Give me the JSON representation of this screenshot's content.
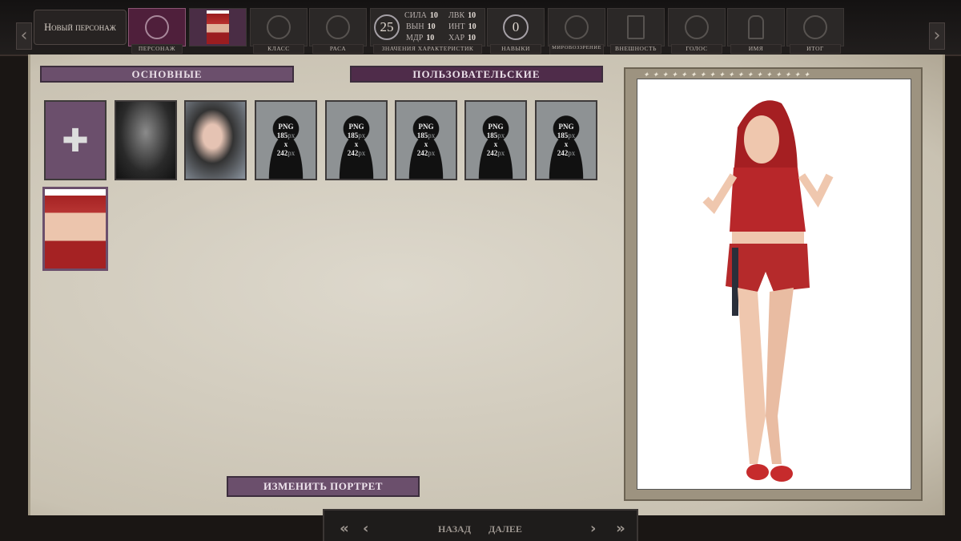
{
  "header": {
    "new_character": "Новый персонаж",
    "tabs": [
      {
        "label": "ПЕРСОНАЖ"
      },
      {
        "label": ""
      },
      {
        "label": "КЛАСС"
      },
      {
        "label": "РАСА"
      },
      {
        "label": "ЗНАЧЕНИЯ ХАРАКТЕРИСТИК"
      },
      {
        "label": "НАВЫКИ"
      },
      {
        "label": "МИРОВОЗЗРЕНИЕ"
      },
      {
        "label": "ВНЕШНОСТЬ"
      },
      {
        "label": "ГОЛОС"
      },
      {
        "label": "ИМЯ"
      },
      {
        "label": "ИТОГ"
      }
    ],
    "points": "25",
    "skills_points": "0",
    "stats": [
      {
        "name": "СИЛА",
        "value": "10"
      },
      {
        "name": "ЛВК",
        "value": "10"
      },
      {
        "name": "ВЫН",
        "value": "10"
      },
      {
        "name": "ИНТ",
        "value": "10"
      },
      {
        "name": "МДР",
        "value": "10"
      },
      {
        "name": "ХАР",
        "value": "10"
      }
    ]
  },
  "portraits": {
    "tab_basic": "ОСНОВНЫЕ",
    "tab_custom": "ПОЛЬЗОВАТЕЛЬСКИЕ",
    "placeholder": {
      "format": "PNG",
      "w": "185",
      "h": "242",
      "unit": "px",
      "x": "x"
    },
    "change_button": "ИЗМЕНИТЬ ПОРТРЕТ"
  },
  "footer": {
    "back": "НАЗАД",
    "next": "ДАЛЕЕ"
  },
  "colors": {
    "accent": "#6b4f6c",
    "active_tab": "#4f1f3b",
    "parchment": "#d6d0c3"
  }
}
